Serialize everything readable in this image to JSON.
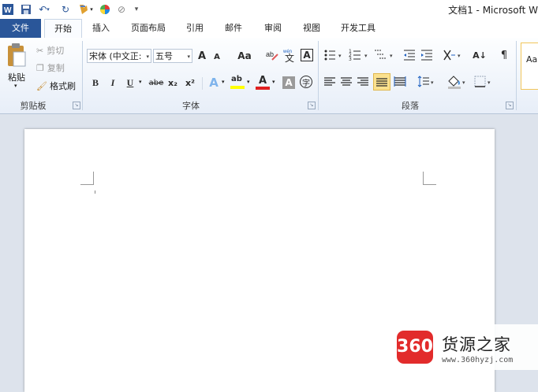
{
  "title_bar": {
    "title": "文档1 - Microsoft W",
    "quick_access": [
      {
        "icon": "word-logo-icon"
      },
      {
        "icon": "save-icon"
      },
      {
        "icon": "undo-icon"
      },
      {
        "icon": "repeat-icon"
      },
      {
        "icon": "format-painter-icon"
      },
      {
        "icon": "color-wheel-icon"
      },
      {
        "icon": "eraser-icon"
      },
      {
        "icon": "customize-qat-icon"
      }
    ]
  },
  "tabs": [
    {
      "label": "文件"
    },
    {
      "label": "开始"
    },
    {
      "label": "插入"
    },
    {
      "label": "页面布局"
    },
    {
      "label": "引用"
    },
    {
      "label": "邮件"
    },
    {
      "label": "审阅"
    },
    {
      "label": "视图"
    },
    {
      "label": "开发工具"
    }
  ],
  "clipboard": {
    "paste_label": "粘贴",
    "cut_label": "剪切",
    "copy_label": "复制",
    "format_painter_label": "格式刷",
    "group_label": "剪贴板"
  },
  "font": {
    "font_name": "宋体 (中文正:",
    "font_size": "五号",
    "group_label": "字体",
    "grow": "A",
    "shrink": "A",
    "change_case": "Aa",
    "bold": "B",
    "italic": "I",
    "underline": "U",
    "strikethrough": "abe",
    "subscript": "x₂",
    "superscript": "x²",
    "text_effect": "A",
    "highlight": "ab",
    "font_color": "A",
    "char_shading": "A",
    "enclose_char": "字",
    "phonetic": "wén",
    "border_char": "A"
  },
  "paragraph": {
    "group_label": "段落",
    "sort": "A↓",
    "show_marks": "¶"
  },
  "styles": {
    "preview": "Aa"
  },
  "watermark": {
    "badge": "360",
    "title": "货源之家",
    "url": "www.360hyzj.com"
  },
  "colors": {
    "file_tab": "#2a5699",
    "ribbon_top": "#fdfeff",
    "ribbon_bottom": "#e7eef8",
    "doc_background": "#dde3ec",
    "highlight_yellow": "#ffff00",
    "font_red": "#e02020",
    "badge_red": "#e22b2b"
  }
}
